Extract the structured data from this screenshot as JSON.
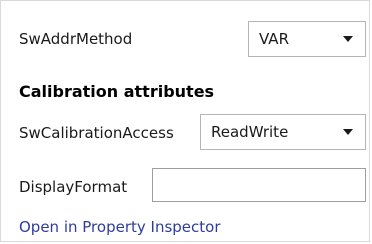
{
  "swaddr": {
    "label": "SwAddrMethod",
    "selected": "VAR"
  },
  "calibration": {
    "heading": "Calibration attributes",
    "access_label": "SwCalibrationAccess",
    "access_selected": "ReadWrite"
  },
  "display_format": {
    "label": "DisplayFormat",
    "value": ""
  },
  "footer": {
    "link_text": "Open in Property Inspector"
  },
  "colors": {
    "link": "#2f3c9e",
    "border": "#b5b5b5"
  }
}
